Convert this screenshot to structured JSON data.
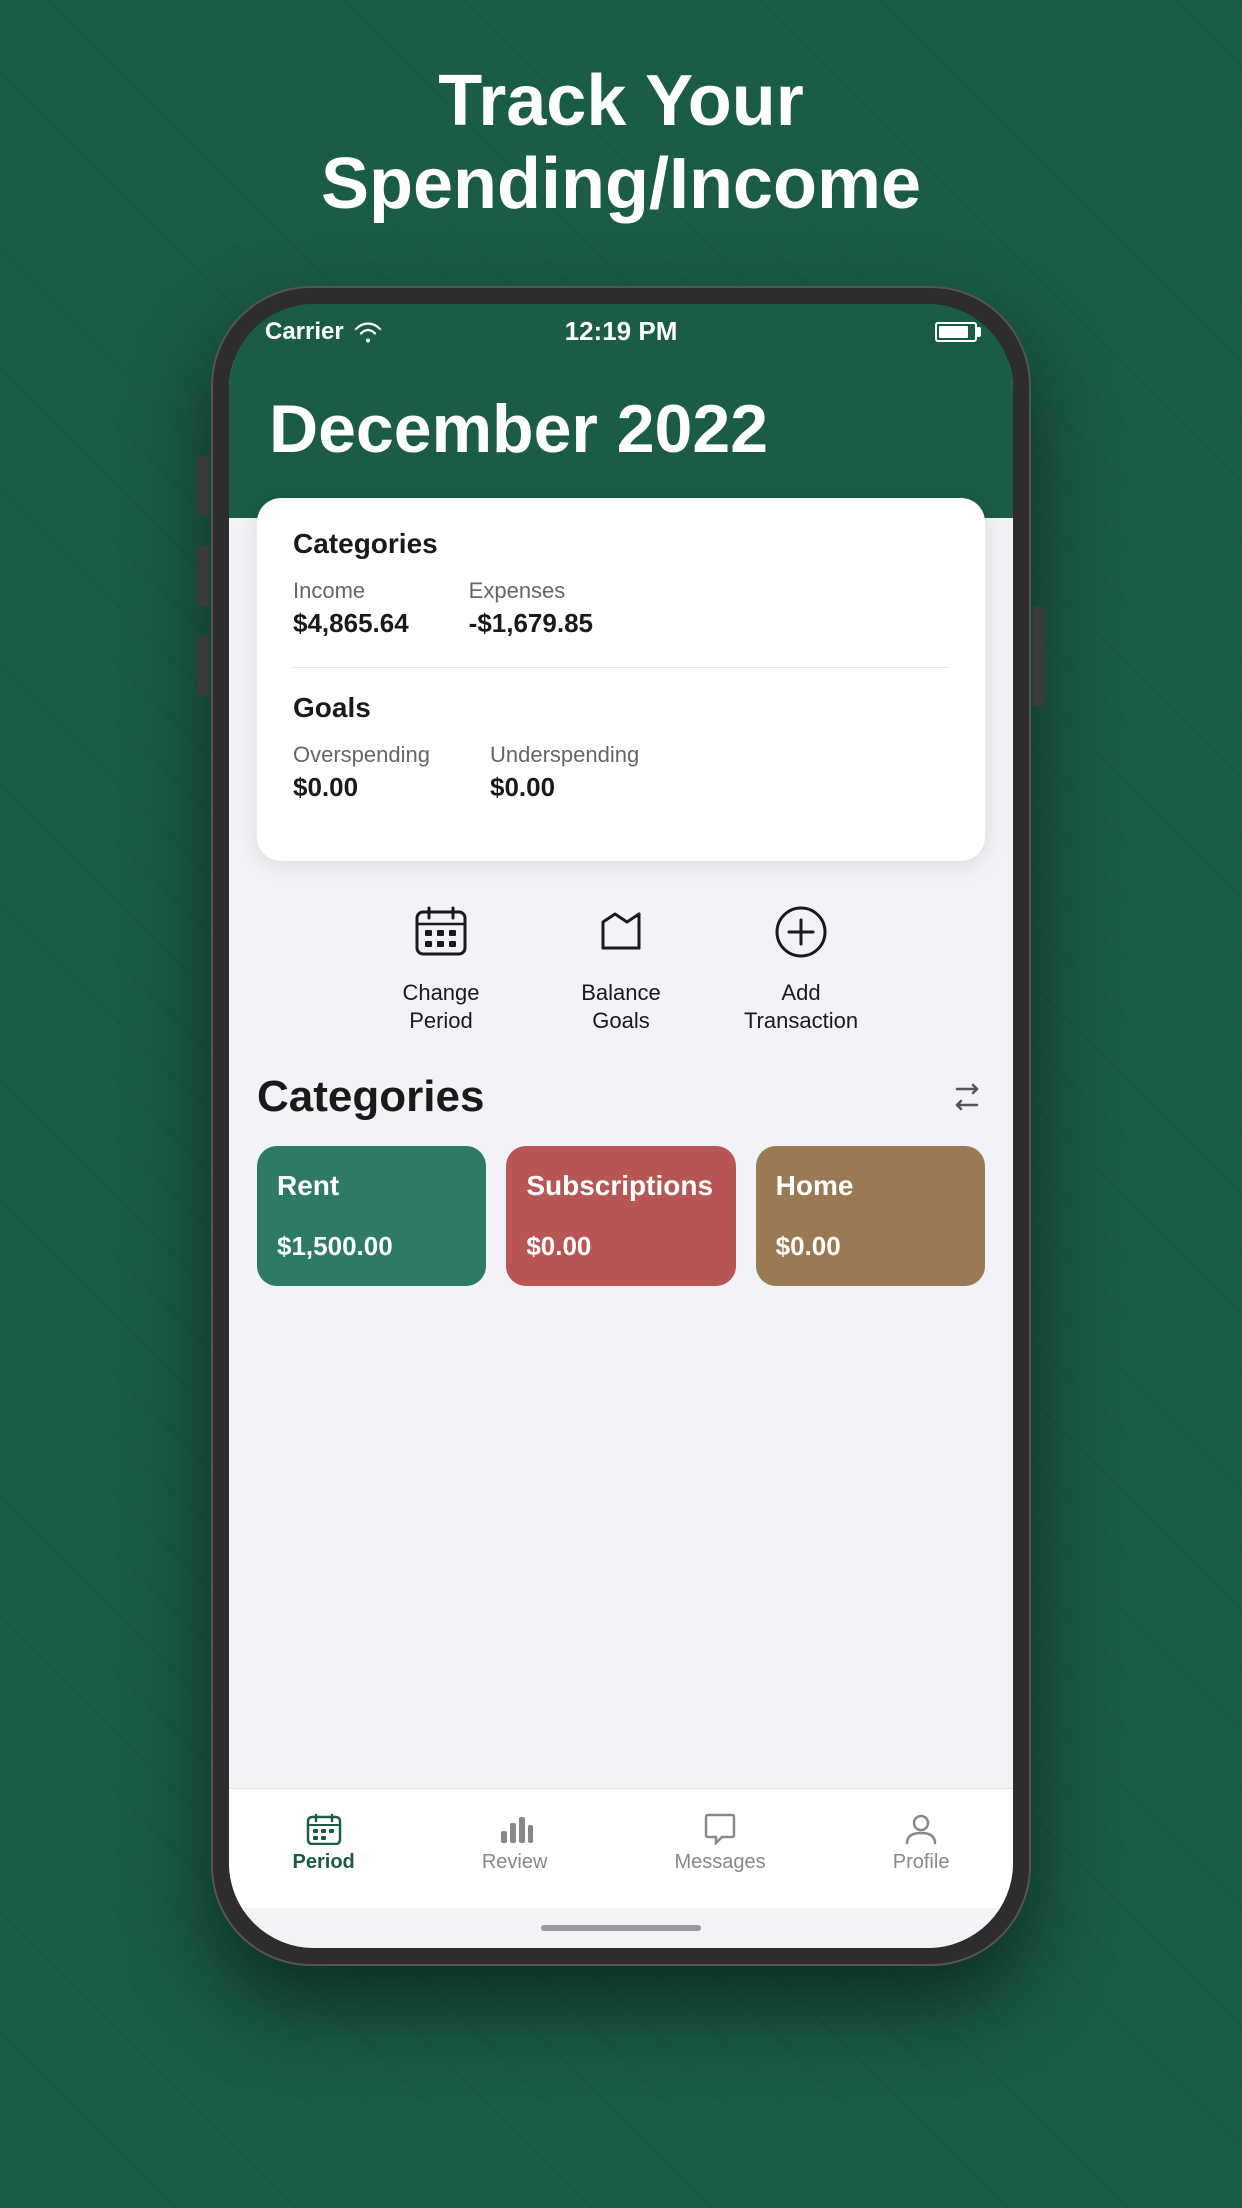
{
  "page": {
    "headline_line1": "Track Your",
    "headline_line2": "Spending/Income"
  },
  "status_bar": {
    "carrier": "Carrier",
    "time": "12:19 PM"
  },
  "header": {
    "month_title": "December 2022"
  },
  "summary_card": {
    "categories_title": "Categories",
    "income_label": "Income",
    "income_value": "$4,865.64",
    "expenses_label": "Expenses",
    "expenses_value": "-$1,679.85",
    "goals_title": "Goals",
    "overspending_label": "Overspending",
    "overspending_value": "$0.00",
    "underspending_label": "Underspending",
    "underspending_value": "$0.00"
  },
  "actions": {
    "change_period_label": "Change\nPeriod",
    "balance_goals_label": "Balance\nGoals",
    "add_transaction_label": "Add\nTransaction"
  },
  "categories_section": {
    "title": "Categories",
    "cards": [
      {
        "name": "Rent",
        "amount": "$1,500.00",
        "color": "#2d7a65"
      },
      {
        "name": "Subscriptions",
        "amount": "$0.00",
        "color": "#b85555"
      },
      {
        "name": "Home",
        "amount": "$0.00",
        "color": "#9a7a55"
      }
    ]
  },
  "tab_bar": {
    "tabs": [
      {
        "label": "Period",
        "active": true
      },
      {
        "label": "Review",
        "active": false
      },
      {
        "label": "Messages",
        "active": false
      },
      {
        "label": "Profile",
        "active": false
      }
    ]
  }
}
